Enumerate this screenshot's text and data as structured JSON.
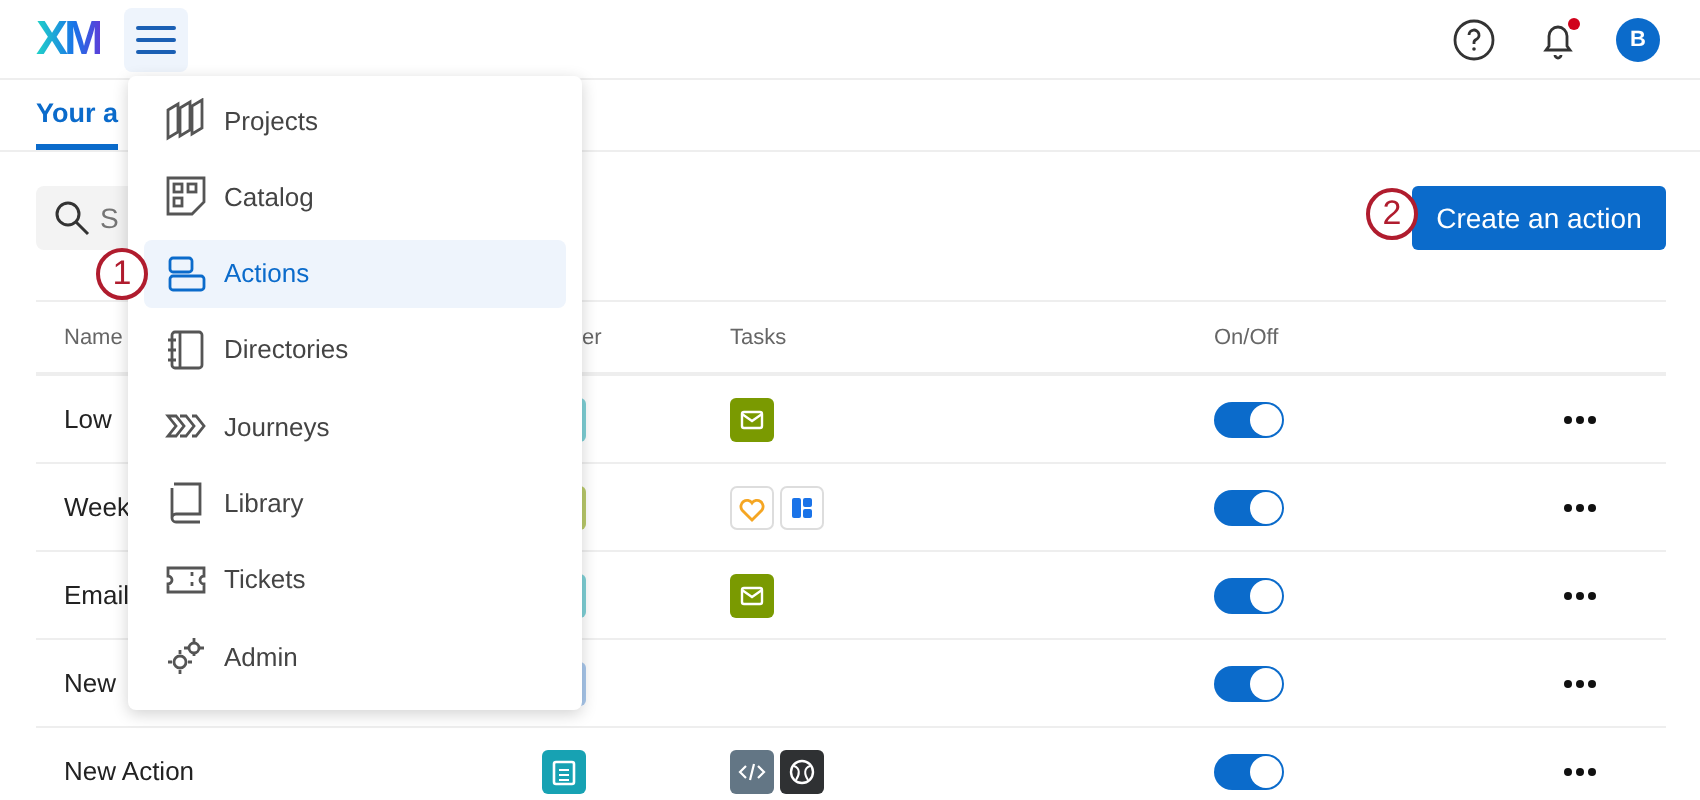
{
  "header": {
    "logo": "XM",
    "avatar": "B",
    "notification_unread": true
  },
  "tabs": [
    {
      "label": "Your a",
      "selected": true
    }
  ],
  "search": {
    "placeholder": "S"
  },
  "create_button": "Create an action",
  "annotations": [
    {
      "number": "1"
    },
    {
      "number": "2"
    }
  ],
  "table": {
    "columns": [
      "Name",
      "er",
      "Tasks",
      "On/Off"
    ],
    "rows": [
      {
        "name": "Low",
        "trigger": {
          "color": "#7fd0d6"
        },
        "tasks": [
          {
            "kind": "email"
          }
        ],
        "on": true
      },
      {
        "name": "Week",
        "trigger": {
          "color": "#b9c96a"
        },
        "tasks": [
          {
            "kind": "heart"
          },
          {
            "kind": "tile"
          }
        ],
        "on": true
      },
      {
        "name": "Email",
        "trigger": {
          "color": "#7fd0d6"
        },
        "tasks": [
          {
            "kind": "email"
          }
        ],
        "on": true
      },
      {
        "name": "New",
        "trigger": {
          "color": "#a9c8ec"
        },
        "tasks": [],
        "on": true
      },
      {
        "name": "New Action",
        "trigger": {
          "color": "#17a2b3"
        },
        "tasks": [
          {
            "kind": "code"
          },
          {
            "kind": "globe"
          }
        ],
        "on": true
      }
    ]
  },
  "menu": {
    "items": [
      {
        "label": "Projects",
        "kind": "projects",
        "selected": false
      },
      {
        "label": "Catalog",
        "kind": "catalog",
        "selected": false
      },
      {
        "label": "Actions",
        "kind": "actions",
        "selected": true
      },
      {
        "label": "Directories",
        "kind": "directories",
        "selected": false
      },
      {
        "label": "Journeys",
        "kind": "journeys",
        "selected": false
      },
      {
        "label": "Library",
        "kind": "library",
        "selected": false
      },
      {
        "label": "Tickets",
        "kind": "tickets",
        "selected": false
      },
      {
        "label": "Admin",
        "kind": "admin",
        "selected": false
      }
    ]
  }
}
